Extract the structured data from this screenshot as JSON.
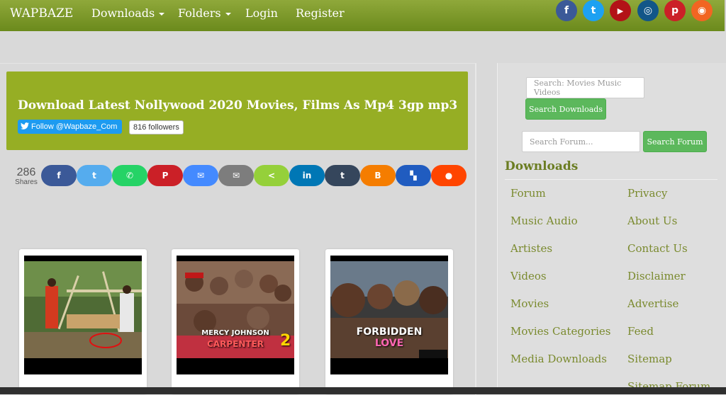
{
  "navbar": {
    "brand": "WAPBAZE",
    "items": [
      {
        "label": "Downloads",
        "dropdown": true
      },
      {
        "label": "Folders",
        "dropdown": true
      },
      {
        "label": "Login",
        "dropdown": false
      },
      {
        "label": "Register",
        "dropdown": false
      }
    ],
    "social": [
      {
        "name": "facebook",
        "glyph": "f",
        "color": "#3b5998"
      },
      {
        "name": "twitter",
        "glyph": "t",
        "color": "#1da1f2"
      },
      {
        "name": "youtube",
        "glyph": "▶",
        "color": "#b31217"
      },
      {
        "name": "instagram",
        "glyph": "◎",
        "color": "#125688"
      },
      {
        "name": "pinterest",
        "glyph": "p",
        "color": "#cb2027"
      },
      {
        "name": "rss",
        "glyph": "◉",
        "color": "#f26522"
      }
    ]
  },
  "banner": {
    "title": "Download Latest Nollywood 2020 Movies, Films As Mp4 3gp mp3",
    "follow_label": "Follow @Wapbaze_Com",
    "followers": "816 followers"
  },
  "share": {
    "count": "286",
    "count_label": "Shares",
    "buttons": [
      {
        "name": "facebook",
        "glyph": "f",
        "color": "#3b5998"
      },
      {
        "name": "twitter",
        "glyph": "t",
        "color": "#55acee"
      },
      {
        "name": "whatsapp",
        "glyph": "✆",
        "color": "#25d366"
      },
      {
        "name": "pinterest",
        "glyph": "P",
        "color": "#cb2027"
      },
      {
        "name": "messenger",
        "glyph": "✉",
        "color": "#448aff"
      },
      {
        "name": "email",
        "glyph": "✉",
        "color": "#7d7d7d"
      },
      {
        "name": "sharethis",
        "glyph": "<",
        "color": "#95d03a"
      },
      {
        "name": "linkedin",
        "glyph": "in",
        "color": "#0077b5"
      },
      {
        "name": "tumblr",
        "glyph": "t",
        "color": "#35465c"
      },
      {
        "name": "blogger",
        "glyph": "B",
        "color": "#f57d00"
      },
      {
        "name": "delicious",
        "glyph": "▚",
        "color": "#205cc0"
      },
      {
        "name": "reddit",
        "glyph": "●",
        "color": "#ff4500"
      }
    ]
  },
  "thumbnails": [
    {
      "name": "movie-thumbnail-1",
      "caption_main": "",
      "caption_sub": ""
    },
    {
      "name": "movie-thumbnail-2",
      "caption_main": "MERCY JOHNSON",
      "caption_sub": "CARPENTER",
      "badge": "2"
    },
    {
      "name": "movie-thumbnail-3",
      "caption_main": "FORBIDDEN",
      "caption_sub": "LOVE"
    }
  ],
  "sidebar": {
    "search_downloads_placeholder": "Search: Movies Music Videos",
    "search_downloads_button": "Search Downloads",
    "search_forum_placeholder": "Search Forum...",
    "search_forum_button": "Search Forum",
    "section_title": "Downloads",
    "links_left": [
      "Forum",
      "Music Audio",
      "Artistes",
      "Videos",
      "Movies",
      "Movies Categories",
      "Media Downloads"
    ],
    "links_right": [
      "Privacy",
      "About Us",
      "Contact Us",
      "Disclaimer",
      "Advertise",
      "Feed",
      "Sitemap",
      "Sitemap Forum"
    ]
  }
}
